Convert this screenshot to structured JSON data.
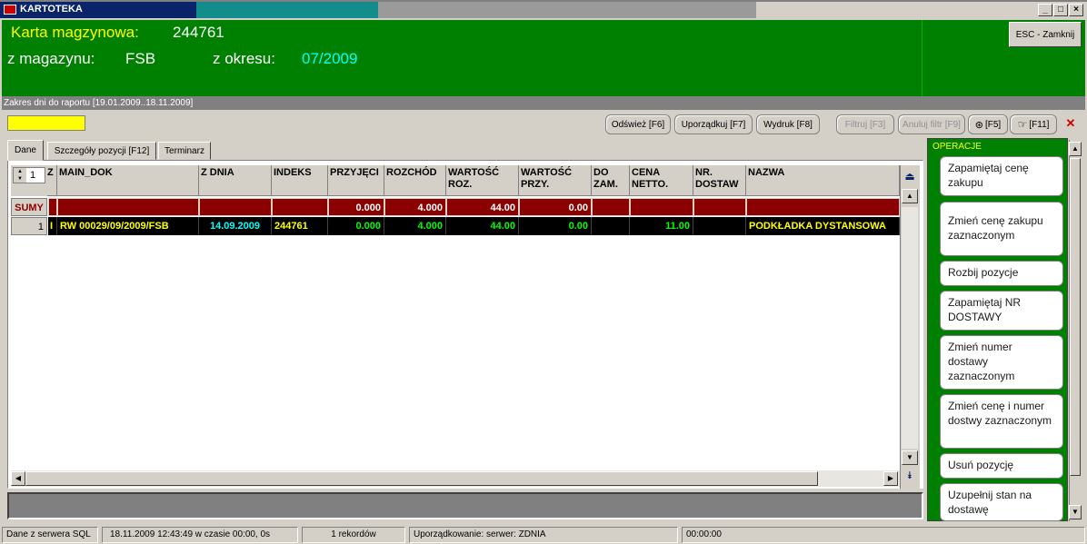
{
  "window": {
    "title": "KARTOTEKA",
    "min_glyph": "_",
    "max_glyph": "□",
    "close_glyph": "×"
  },
  "header": {
    "karta_label": "Karta magzynowa:",
    "karta_value": "244761",
    "magazyn_label": "z magazynu:",
    "magazyn_value": "FSB",
    "okres_label": "z okresu:",
    "okres_value": "07/2009",
    "esc_button": "ESC - Zamknij"
  },
  "range_text": "Zakres dni do raportu [19.01.2009..18.11.2009]",
  "toolbar": {
    "refresh": "Odśwież [F6]",
    "sort": "Uporządkuj [F7]",
    "print": "Wydruk [F8]",
    "filter": "Filtruj [F3]",
    "cancel_filter": "Anuluj filtr [F9]",
    "f5": "[F5]",
    "f11": "[F11]"
  },
  "tabs": [
    "Dane",
    "Szczegóły pozycji [F12]",
    "Terminarz"
  ],
  "grid": {
    "spin_value": "1",
    "columns": [
      "Z",
      "MAIN_DOK",
      "Z DNIA",
      "INDEKS",
      "PRZYJĘCI",
      "ROZCHÓD",
      "WARTOŚĆ ROZ.",
      "WARTOŚĆ PRZY.",
      "DO ZAM.",
      "CENA NETTO.",
      "NR. DOSTAW",
      "NAZWA"
    ],
    "sumy_label": "SUMY",
    "sumy": {
      "przyjecie": "0.000",
      "rozchod": "4.000",
      "wartosc_roz": "44.00",
      "wartosc_przy": "0.00"
    },
    "rows": [
      {
        "num": "1",
        "z": "I",
        "main_dok": "RW 00029/09/2009/FSB",
        "z_dnia": "14.09.2009",
        "indeks": "244761",
        "przyjecie": "0.000",
        "rozchod": "4.000",
        "wartosc_roz": "44.00",
        "wartosc_przy": "0.00",
        "do_zam": "",
        "cena_netto": "11.00",
        "nr_dostaw": "",
        "nazwa": "PODKŁADKA DYSTANSOWA"
      }
    ]
  },
  "operations": {
    "title": "OPERACJE",
    "buttons": [
      "Zapamiętaj cenę zakupu",
      "Zmień cenę zakupu zaznaczonym",
      "Rozbij pozycje",
      "Zapamiętaj NR DOSTAWY",
      "Zmień numer dostawy zaznaczonym",
      "Zmień cenę i numer dostwy zaznaczonym",
      "Usuń pozycję",
      "Uzupełnij stan na dostawę"
    ]
  },
  "status": {
    "source": "Dane z serwera SQL",
    "datetime": "18.11.2009 12:43:49 w czasie 00:00, 0s",
    "records": "1 rekordów",
    "sort": "Uporządkowanie:  serwer: ZDNIA",
    "time": "00:00:00"
  },
  "colors": {
    "header_green": "#008000",
    "label_yellow": "#ffff00",
    "period_cyan": "#00ffff",
    "sum_red": "#8b0000",
    "row_black": "#000000"
  }
}
